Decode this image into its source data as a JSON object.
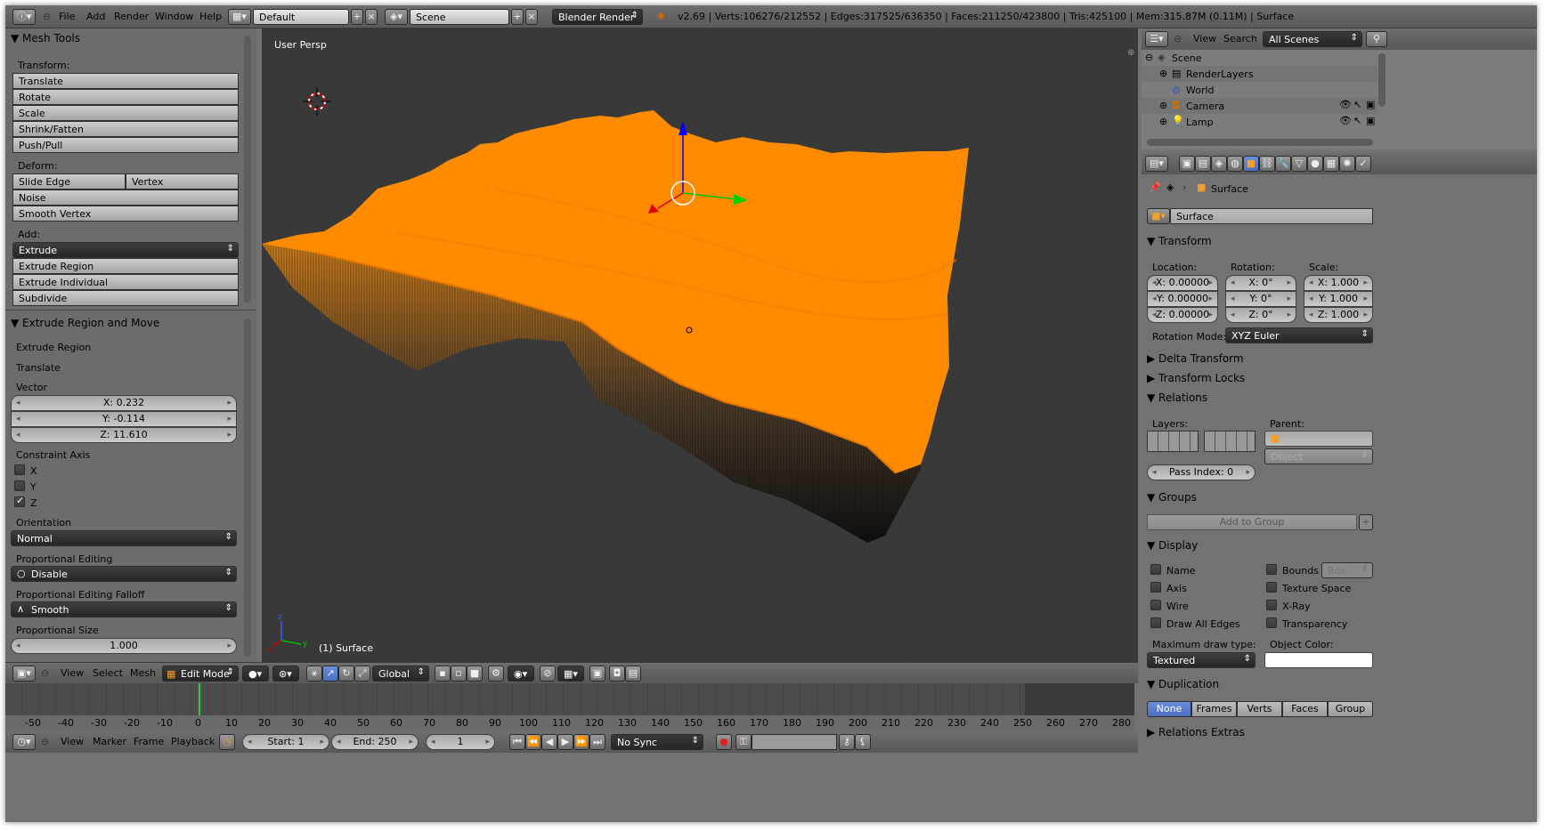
{
  "app": {
    "version_stats": "v2.69 | Verts:106276/212552 | Edges:317525/636350 | Faces:211250/423800 | Tris:425100 | Mem:315.87M (0.11M) | Surface"
  },
  "menus": {
    "file": "File",
    "add": "Add",
    "render": "Render",
    "window": "Window",
    "help": "Help"
  },
  "top": {
    "layout": "Default",
    "scene": "Scene",
    "engine": "Blender Render"
  },
  "toolshelf": {
    "title": "Mesh Tools",
    "transform_label": "Transform:",
    "transform": [
      "Translate",
      "Rotate",
      "Scale",
      "Shrink/Fatten",
      "Push/Pull"
    ],
    "deform_label": "Deform:",
    "slide_edge": "Slide Edge",
    "vertex": "Vertex",
    "noise": "Noise",
    "smooth_vertex": "Smooth Vertex",
    "add_label": "Add:",
    "extrude": "Extrude",
    "add_items": [
      "Extrude Region",
      "Extrude Individual",
      "Subdivide"
    ]
  },
  "operator": {
    "title": "Extrude Region and Move",
    "extrude_region": "Extrude Region",
    "translate": "Translate",
    "vector_label": "Vector",
    "x": "X: 0.232",
    "y": "Y: -0.114",
    "z": "Z: 11.610",
    "constraint_label": "Constraint Axis",
    "cx": "X",
    "cy": "Y",
    "cz": "Z",
    "orientation_label": "Orientation",
    "orientation": "Normal",
    "prop_label": "Proportional Editing",
    "prop": "Disable",
    "falloff_label": "Proportional Editing Falloff",
    "falloff": "Smooth",
    "size_label": "Proportional Size",
    "size": "1.000"
  },
  "viewport": {
    "view_name": "User Persp",
    "object_info": "(1) Surface",
    "header": {
      "view": "View",
      "select": "Select",
      "mesh": "Mesh",
      "mode": "Edit Mode",
      "orientation": "Global"
    },
    "accent": "#ff8c00"
  },
  "timeline": {
    "ticks": [
      "-50",
      "-40",
      "-30",
      "-20",
      "-10",
      "0",
      "10",
      "20",
      "30",
      "40",
      "50",
      "60",
      "70",
      "80",
      "90",
      "100",
      "110",
      "120",
      "130",
      "140",
      "150",
      "160",
      "170",
      "180",
      "190",
      "200",
      "210",
      "220",
      "230",
      "240",
      "250",
      "260",
      "270",
      "280"
    ],
    "view": "View",
    "marker": "Marker",
    "frame": "Frame",
    "playback": "Playback",
    "start": "Start: 1",
    "end": "End: 250",
    "current": "1",
    "sync": "No Sync"
  },
  "outliner": {
    "view": "View",
    "search": "Search",
    "scenes": "All Scenes",
    "items": [
      "Scene",
      "RenderLayers",
      "World",
      "Camera",
      "Lamp"
    ]
  },
  "properties": {
    "breadcrumb": "Surface",
    "object_name": "Surface",
    "transform": "Transform",
    "location": "Location:",
    "rotation": "Rotation:",
    "scale": "Scale:",
    "loc": [
      "X: 0.00000",
      "Y: 0.00000",
      "Z: 0.00000"
    ],
    "rot": [
      "X: 0°",
      "Y: 0°",
      "Z: 0°"
    ],
    "scl": [
      "X: 1.000",
      "Y: 1.000",
      "Z: 1.000"
    ],
    "rotation_mode_label": "Rotation Mode:",
    "rotation_mode": "XYZ Euler",
    "delta": "Delta Transform",
    "locks": "Transform Locks",
    "relations": "Relations",
    "layers": "Layers:",
    "parent": "Parent:",
    "parent_type": "Object",
    "pass_index": "Pass Index: 0",
    "groups": "Groups",
    "add_to_group": "Add to Group",
    "display": "Display",
    "name": "Name",
    "axis": "Axis",
    "wire": "Wire",
    "draw_all_edges": "Draw All Edges",
    "bounds": "Bounds",
    "bounds_type": "Box",
    "texture_space": "Texture Space",
    "xray": "X-Ray",
    "transparency": "Transparency",
    "max_draw_label": "Maximum draw type:",
    "max_draw": "Textured",
    "object_color": "Object Color:",
    "duplication": "Duplication",
    "dup": [
      "None",
      "Frames",
      "Verts",
      "Faces",
      "Group"
    ],
    "relations_extras": "Relations Extras"
  }
}
